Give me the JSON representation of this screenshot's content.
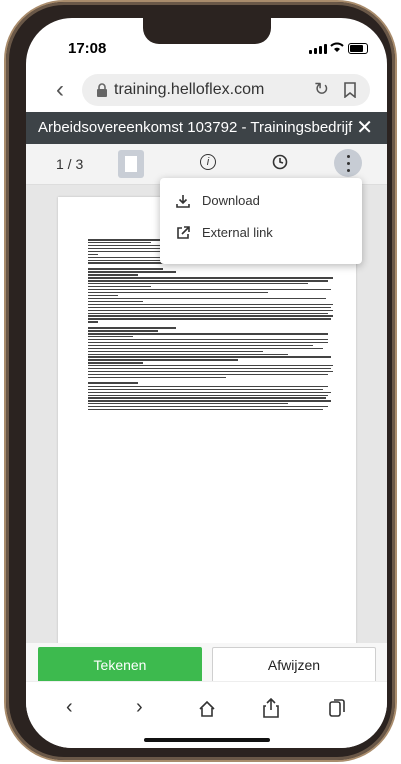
{
  "status": {
    "time": "17:08"
  },
  "browser": {
    "url": "training.helloflex.com"
  },
  "document": {
    "title": "Arbeidsovereenkomst 103792 - Trainingsbedrijf",
    "page_indicator": "1 / 3"
  },
  "menu": {
    "items": [
      {
        "label": "Download"
      },
      {
        "label": "External link"
      }
    ]
  },
  "actions": {
    "sign_label": "Tekenen",
    "reject_label": "Afwijzen"
  },
  "colors": {
    "sign_button": "#3dba4e",
    "doc_header": "#3d4347"
  },
  "icons": [
    "back-icon",
    "lock-icon",
    "reload-icon",
    "bookmark-icon",
    "close-icon",
    "page-thumbnail-icon",
    "info-icon",
    "history-icon",
    "more-icon",
    "download-icon",
    "external-link-icon",
    "forward-icon",
    "home-icon",
    "share-icon",
    "tabs-icon"
  ]
}
